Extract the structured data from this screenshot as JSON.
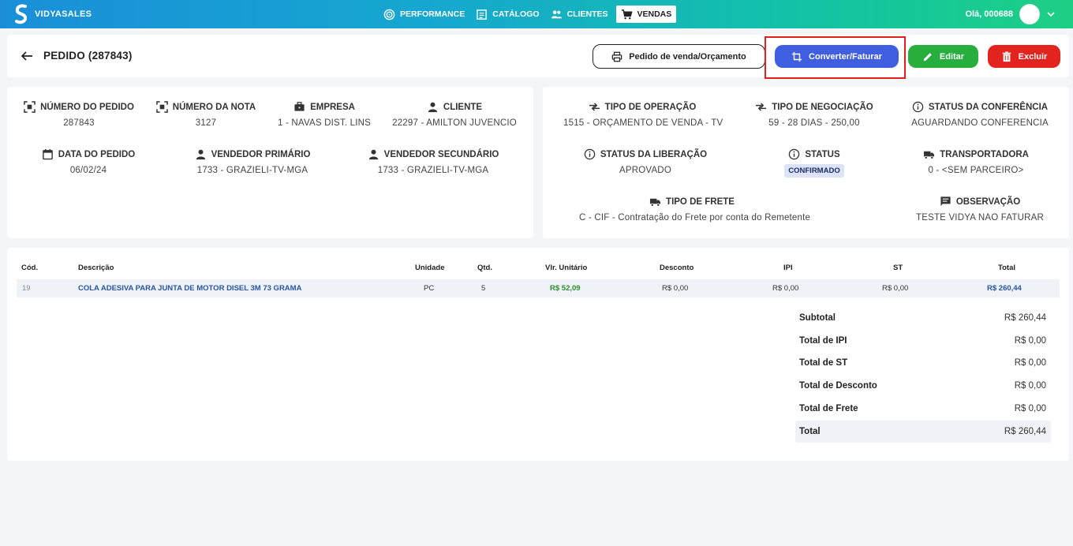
{
  "brand": {
    "name": "VIDYASALES"
  },
  "nav": [
    {
      "label": "PERFORMANCE",
      "icon": "target-icon"
    },
    {
      "label": "CATÁLOGO",
      "icon": "catalog-icon"
    },
    {
      "label": "CLIENTES",
      "icon": "people-icon"
    },
    {
      "label": "VENDAS",
      "icon": "cart-icon",
      "active": true
    }
  ],
  "user": {
    "greeting": "Olá, 000688"
  },
  "header": {
    "title": "PEDIDO (287843)",
    "print_label": "Pedido de venda/Orçamento",
    "convert_label": "Converter/Faturar",
    "edit_label": "Editar",
    "delete_label": "Excluir"
  },
  "info_left": {
    "numero_pedido": {
      "label": "NÚMERO DO PEDIDO",
      "value": "287843"
    },
    "numero_nota": {
      "label": "NÚMERO DA NOTA",
      "value": "3127"
    },
    "empresa": {
      "label": "EMPRESA",
      "value": "1 - NAVAS DIST. LINS"
    },
    "cliente": {
      "label": "CLIENTE",
      "value": "22297 - AMILTON JUVENCIO"
    },
    "data_pedido": {
      "label": "DATA DO PEDIDO",
      "value": "06/02/24"
    },
    "vendedor_primario": {
      "label": "VENDEDOR PRIMÁRIO",
      "value": "1733 - GRAZIELI-TV-MGA"
    },
    "vendedor_secundario": {
      "label": "VENDEDOR SECUNDÁRIO",
      "value": "1733 - GRAZIELI-TV-MGA"
    }
  },
  "info_right": {
    "tipo_operacao": {
      "label": "TIPO DE OPERAÇÃO",
      "value": "1515 - ORÇAMENTO DE VENDA - TV"
    },
    "tipo_negociacao": {
      "label": "TIPO DE NEGOCIAÇÃO",
      "value": "59 - 28 DIAS - 250,00"
    },
    "status_conferencia": {
      "label": "STATUS DA CONFERÊNCIA",
      "value": "AGUARDANDO CONFERENCIA"
    },
    "status_liberacao": {
      "label": "STATUS DA LIBERAÇÃO",
      "value": "APROVADO"
    },
    "status": {
      "label": "STATUS",
      "value": "CONFIRMADO"
    },
    "transportadora": {
      "label": "TRANSPORTADORA",
      "value": "0 - <SEM PARCEIRO>"
    },
    "tipo_frete": {
      "label": "TIPO DE FRETE",
      "value": "C - CIF - Contratação do Frete por conta do Remetente"
    },
    "observacao": {
      "label": "OBSERVAÇÃO",
      "value": "TESTE VIDYA NAO FATURAR"
    }
  },
  "table": {
    "headers": {
      "cod": "Cód.",
      "descricao": "Descrição",
      "unidade": "Unidade",
      "qtd": "Qtd.",
      "vlr_unitario": "Vlr. Unitário",
      "desconto": "Desconto",
      "ipi": "IPI",
      "st": "ST",
      "total": "Total"
    },
    "rows": [
      {
        "cod": "19",
        "descricao": "COLA ADESIVA PARA JUNTA DE MOTOR DISEL 3M 73 GRAMA",
        "unidade": "PC",
        "qtd": "5",
        "vlr_unitario": "R$ 52,09",
        "desconto": "R$ 0,00",
        "ipi": "R$ 0,00",
        "st": "R$ 0,00",
        "total": "R$ 260,44"
      }
    ]
  },
  "summary": [
    {
      "label": "Subtotal",
      "value": "R$ 260,44"
    },
    {
      "label": "Total de IPI",
      "value": "R$ 0,00"
    },
    {
      "label": "Total de ST",
      "value": "R$ 0,00"
    },
    {
      "label": "Total de Desconto",
      "value": "R$ 0,00"
    },
    {
      "label": "Total de Frete",
      "value": "R$ 0,00"
    },
    {
      "label": "Total",
      "value": "R$ 260,44"
    }
  ],
  "colors": {
    "convert": "#3f5ee0",
    "edit": "#27ae3d",
    "delete": "#e3231e",
    "highlight": "#e32020"
  }
}
